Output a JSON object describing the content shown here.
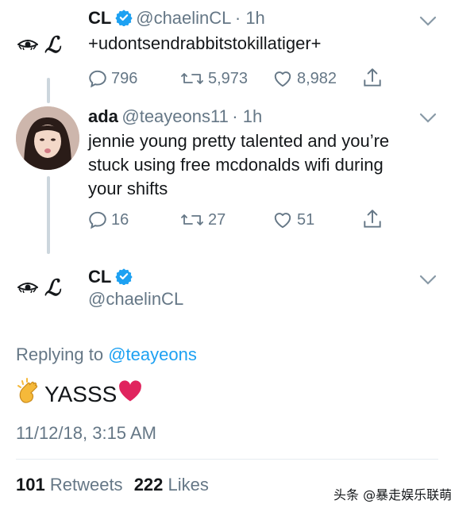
{
  "tweet1": {
    "name": "CL",
    "handle": "@chaelinCL",
    "time": "· 1h",
    "text": "+udontsendrabbitstokillatiger+",
    "replies": "796",
    "retweets": "5,973",
    "likes": "8,982",
    "logo_eye": "👁",
    "logo_letter": "ℒ"
  },
  "tweet2": {
    "name": "ada",
    "handle": "@teayeons11",
    "time": "· 1h",
    "text_lines": [
      "jennie young pretty talented and you’re",
      "stuck using free mcdonalds wifi during",
      "your shifts"
    ],
    "replies": "16",
    "retweets": "27",
    "likes": "51"
  },
  "main_tweet": {
    "name": "CL",
    "handle": "@chaelinCL",
    "replying_prefix": "Replying to",
    "replying_handle": "@teayeons",
    "text": "YASSS",
    "emoji_clap": "👏",
    "emoji_heart": "❤️",
    "timestamp": "11/12/18, 3:15 AM",
    "retweets_count": "101",
    "retweets_label": "Retweets",
    "likes_count": "222",
    "likes_label": "Likes"
  },
  "watermark": "头条 @暴走娱乐联萌",
  "colors": {
    "accent": "#1da1f2",
    "muted": "#657786",
    "heart": "#e0245e"
  }
}
